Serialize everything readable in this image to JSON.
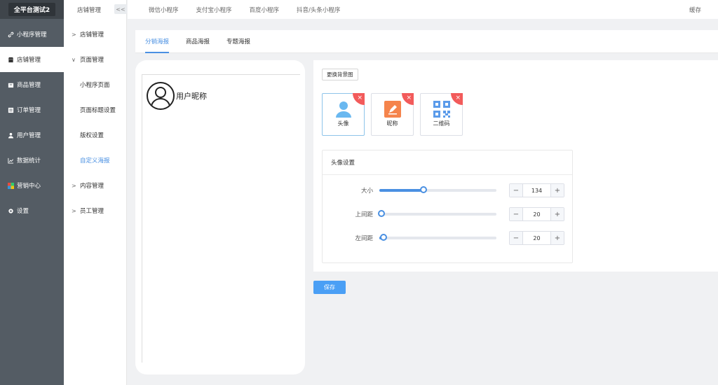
{
  "brand": {
    "title": "全平台测试2"
  },
  "sidebar": {
    "items": [
      {
        "label": "小程序管理",
        "icon": "link-icon"
      },
      {
        "label": "店铺管理",
        "icon": "shop-icon"
      },
      {
        "label": "商品管理",
        "icon": "goods-icon"
      },
      {
        "label": "订单管理",
        "icon": "order-icon"
      },
      {
        "label": "用户管理",
        "icon": "user-icon"
      },
      {
        "label": "数据统计",
        "icon": "chart-icon"
      },
      {
        "label": "营销中心",
        "icon": "marketing-icon"
      },
      {
        "label": "设置",
        "icon": "gear-icon"
      }
    ]
  },
  "submenu": {
    "header": "店铺管理",
    "collapse_label": "<<",
    "items": [
      {
        "label": "店铺管理",
        "arrow": ">"
      },
      {
        "label": "页面管理",
        "arrow": "∨"
      },
      {
        "label": "小程序页面"
      },
      {
        "label": "页面标题设置"
      },
      {
        "label": "版权设置"
      },
      {
        "label": "自定义海报"
      },
      {
        "label": "内容管理",
        "arrow": ">"
      },
      {
        "label": "员工管理",
        "arrow": ">"
      }
    ]
  },
  "topbar": {
    "nav": [
      "微信小程序",
      "支付宝小程序",
      "百度小程序",
      "抖音/头条小程序"
    ],
    "right": "缓存"
  },
  "tabs": [
    "分销海报",
    "商品海报",
    "专题海报"
  ],
  "preview": {
    "nickname": "用户昵称"
  },
  "panel": {
    "bg_button": "更换背景图",
    "elements": [
      {
        "label": "头像",
        "icon": "avatar-icon"
      },
      {
        "label": "昵称",
        "icon": "edit-icon"
      },
      {
        "label": "二维码",
        "icon": "qrcode-icon"
      }
    ],
    "close_symbol": "×",
    "settings": {
      "title": "头像设置",
      "rows": [
        {
          "label": "大小",
          "value": "134",
          "level": 0.36
        },
        {
          "label": "上间距",
          "value": "20",
          "level": 0.0
        },
        {
          "label": "左间距",
          "value": "20",
          "level": 0.02
        }
      ],
      "minus": "−",
      "plus": "+"
    }
  },
  "save_button": "保存",
  "colors": {
    "accent": "#4a90e2",
    "close": "#f25b5b",
    "sidebar": "#545c64"
  }
}
